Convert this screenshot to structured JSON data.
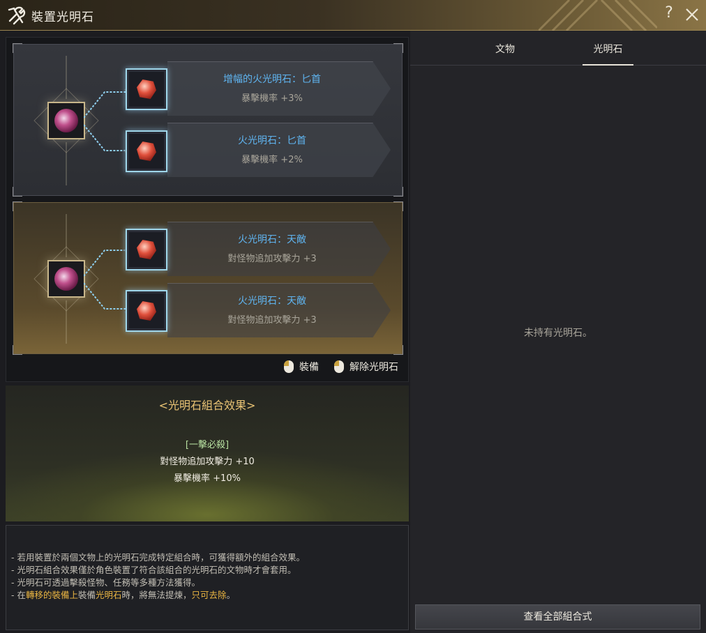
{
  "window": {
    "title": "裝置光明石",
    "help_label": "?",
    "icon": "tools-icon"
  },
  "artifacts": [
    {
      "stones": [
        {
          "name": "增幅的火光明石：匕首",
          "effect": "暴擊機率 +3%"
        },
        {
          "name": "火光明石：匕首",
          "effect": "暴擊機率 +2%"
        }
      ]
    },
    {
      "stones": [
        {
          "name": "火光明石：天敵",
          "effect": "對怪物追加攻擊力 +3"
        },
        {
          "name": "火光明石：天敵",
          "effect": "對怪物追加攻擊力 +3"
        }
      ]
    }
  ],
  "hints": {
    "equip": "裝備",
    "remove": "解除光明石"
  },
  "combo": {
    "title": "<光明石組合效果>",
    "name": "[一擊必殺]",
    "effects": [
      "對怪物追加攻擊力 +10",
      "暴擊機率 +10%"
    ]
  },
  "notes": {
    "line1": "- 若用裝置於兩個文物上的光明石完成特定組合時，可獲得額外的組合效果。",
    "line2": "- 光明石組合效果僅於角色裝置了符合該組合的光明石的文物時才會套用。",
    "line3": "- 光明石可透過擊殺怪物、任務等多種方法獲得。",
    "line4_parts": [
      "- 在",
      "轉移的裝備上",
      "裝備",
      "光明石",
      "時，將無法提煉，",
      "只可去除",
      "。"
    ]
  },
  "right": {
    "tabs": [
      "文物",
      "光明石"
    ],
    "active_tab": "光明石",
    "empty_message": "未持有光明石。",
    "view_all_label": "查看全部組合式"
  },
  "colors": {
    "stone_name": "#5fb4f0",
    "combo_title": "#e8c274",
    "combo_name": "#b7e0a0",
    "highlight": "#e8b442"
  }
}
